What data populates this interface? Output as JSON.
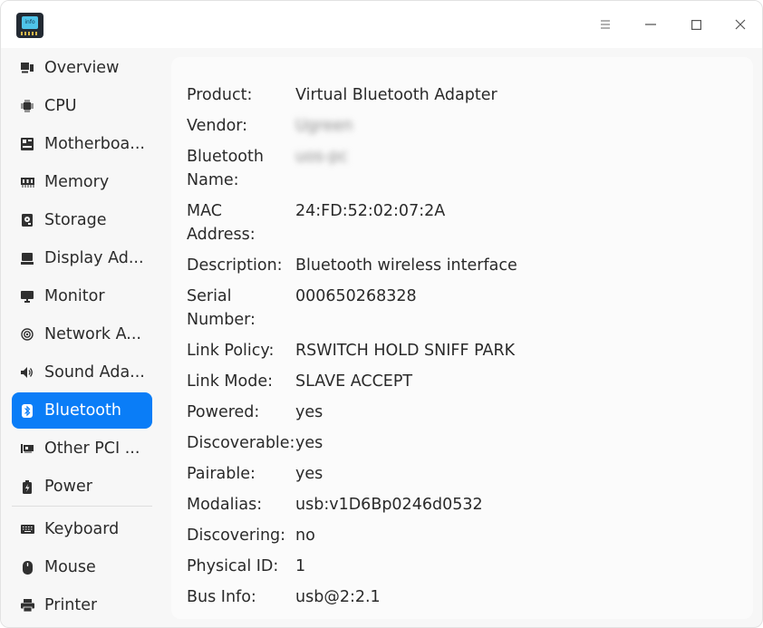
{
  "app": {
    "icon": "hardware-info-app-icon",
    "icon_text": "info"
  },
  "titlebar": {
    "menu_icon": "menu-icon",
    "minimize_icon": "minimize-icon",
    "maximize_icon": "maximize-icon",
    "close_icon": "close-icon"
  },
  "sidebar": {
    "items": [
      {
        "label": "Overview",
        "icon": "overview-icon",
        "active": false
      },
      {
        "label": "CPU",
        "icon": "cpu-icon",
        "active": false
      },
      {
        "label": "Motherboa...",
        "icon": "motherboard-icon",
        "active": false
      },
      {
        "label": "Memory",
        "icon": "memory-icon",
        "active": false
      },
      {
        "label": "Storage",
        "icon": "storage-icon",
        "active": false
      },
      {
        "label": "Display Ad...",
        "icon": "display-adapter-icon",
        "active": false
      },
      {
        "label": "Monitor",
        "icon": "monitor-icon",
        "active": false
      },
      {
        "label": "Network A...",
        "icon": "network-adapter-icon",
        "active": false
      },
      {
        "label": "Sound Ada...",
        "icon": "sound-adapter-icon",
        "active": false
      },
      {
        "label": "Bluetooth",
        "icon": "bluetooth-icon",
        "active": true
      },
      {
        "label": "Other PCI ...",
        "icon": "pci-icon",
        "active": false
      },
      {
        "label": "Power",
        "icon": "power-icon",
        "active": false
      },
      {
        "label": "Keyboard",
        "icon": "keyboard-icon",
        "active": false
      },
      {
        "label": "Mouse",
        "icon": "mouse-icon",
        "active": false
      },
      {
        "label": "Printer",
        "icon": "printer-icon",
        "active": false
      }
    ],
    "accent_color": "#0a7df7"
  },
  "details": {
    "rows": [
      {
        "key": "Product:",
        "value": "Virtual Bluetooth Adapter"
      },
      {
        "key": "Vendor:",
        "value": "Ugreen"
      },
      {
        "key": "Bluetooth Name:",
        "value": "uos-pc"
      },
      {
        "key": "MAC Address:",
        "value": "24:FD:52:02:07:2A"
      },
      {
        "key": "Description:",
        "value": "Bluetooth wireless interface"
      },
      {
        "key": "Serial Number:",
        "value": "000650268328"
      },
      {
        "key": "Link Policy:",
        "value": "RSWITCH HOLD SNIFF PARK"
      },
      {
        "key": "Link Mode:",
        "value": "SLAVE ACCEPT"
      },
      {
        "key": "Powered:",
        "value": "yes"
      },
      {
        "key": "Discoverable:",
        "value": "yes"
      },
      {
        "key": "Pairable:",
        "value": "yes"
      },
      {
        "key": "Modalias:",
        "value": "usb:v1D6Bp0246d0532"
      },
      {
        "key": "Discovering:",
        "value": "no"
      },
      {
        "key": "Physical ID:",
        "value": "1"
      },
      {
        "key": "Bus Info:",
        "value": "usb@2:2.1"
      }
    ]
  }
}
